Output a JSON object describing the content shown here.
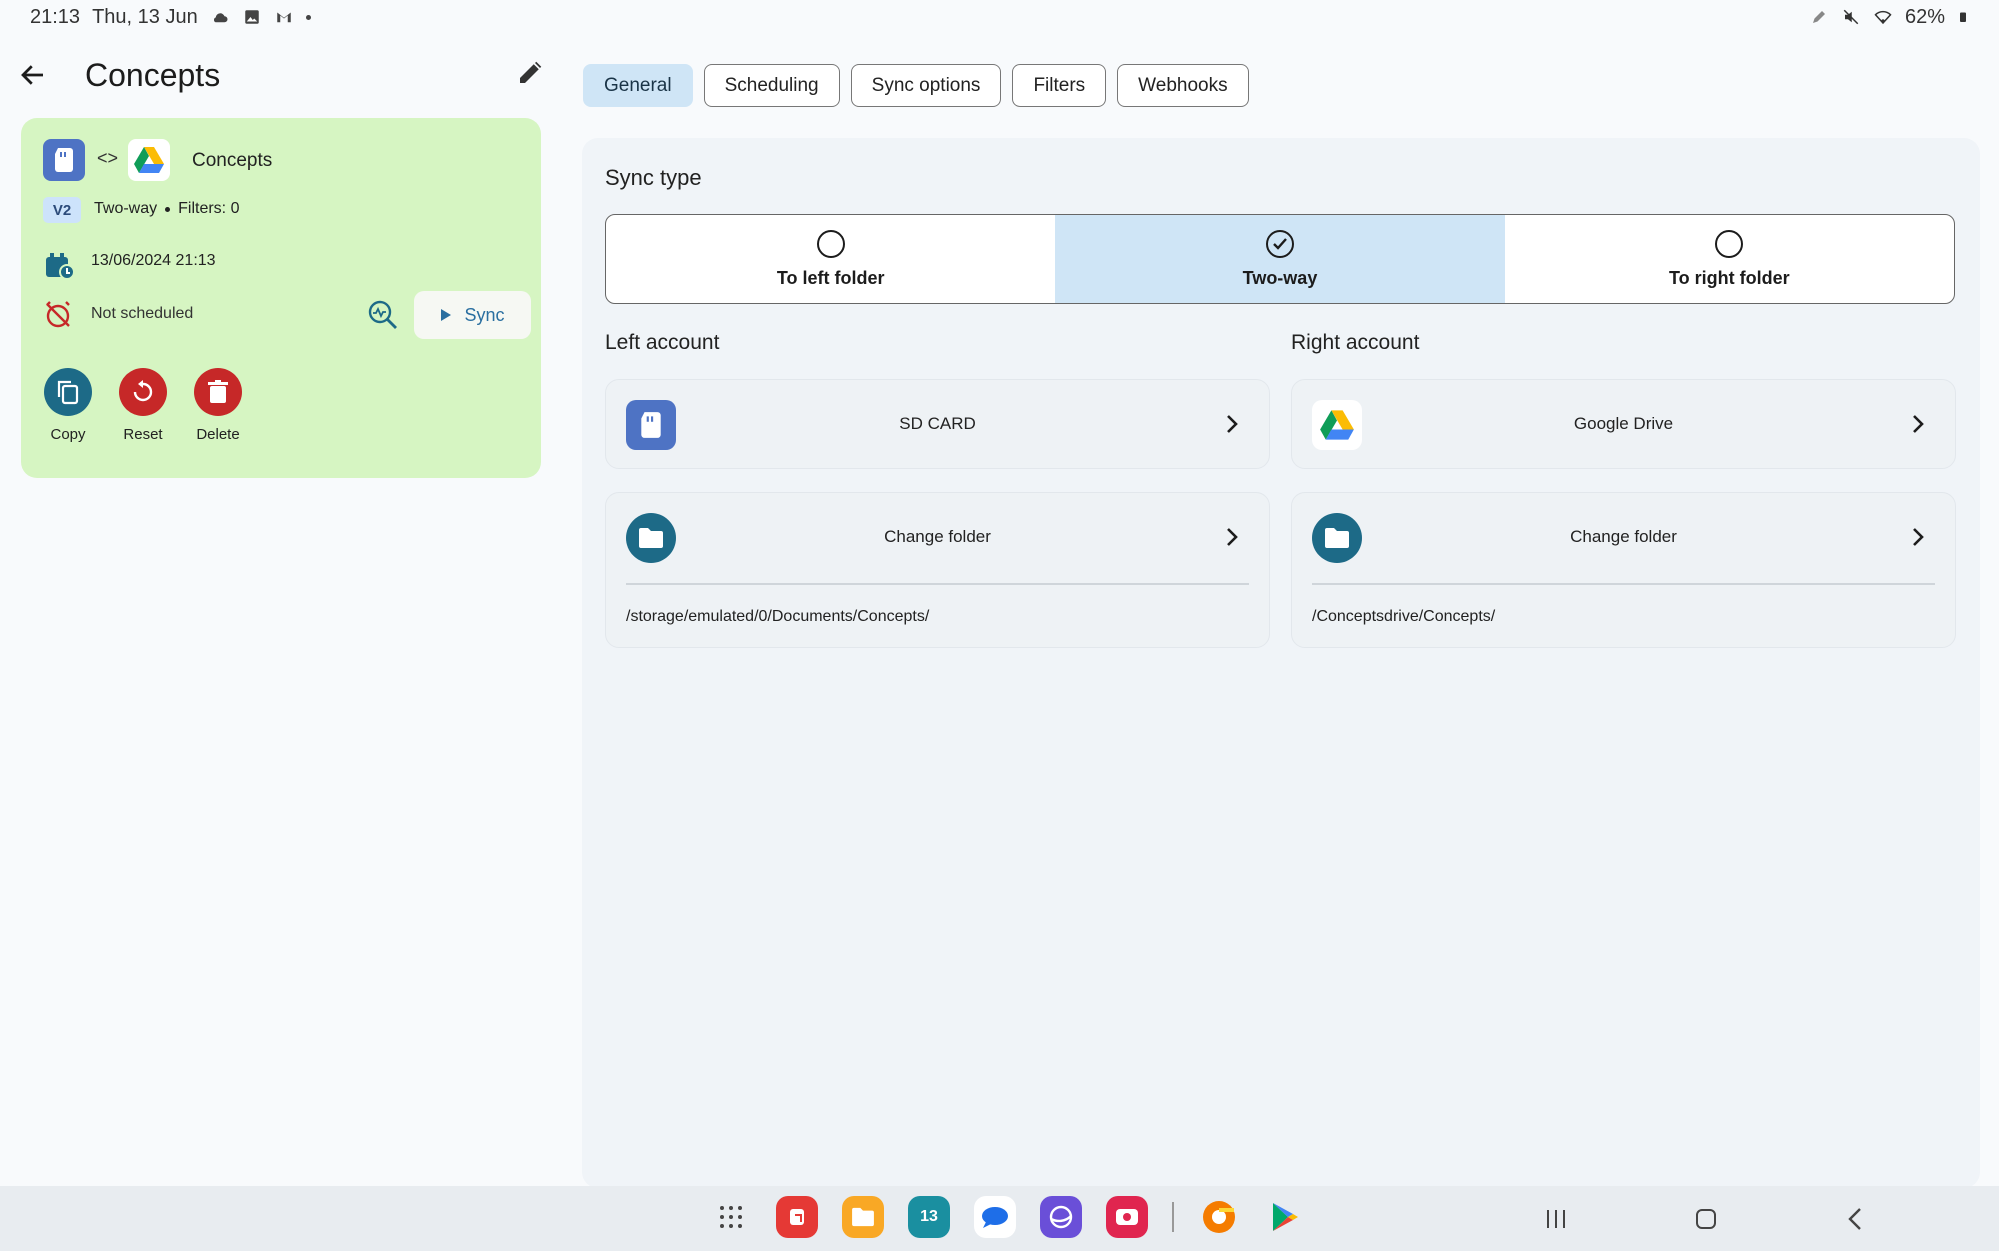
{
  "status_bar": {
    "time": "21:13",
    "date": "Thu, 13 Jun",
    "battery": "62%",
    "icons": [
      "cloud-icon",
      "gallery-icon",
      "gmail-icon",
      "dot-icon",
      "pen-icon",
      "mute-icon",
      "wifi-icon",
      "battery-icon"
    ]
  },
  "header": {
    "title": "Concepts",
    "back_icon": "arrow-left-icon",
    "edit_icon": "pencil-icon"
  },
  "task_card": {
    "name": "Concepts",
    "version_badge": "V2",
    "sync_type": "Two-way",
    "filters": "Filters: 0",
    "last_sync": "13/06/2024 21:13",
    "schedule": "Not scheduled",
    "sync_button": "Sync",
    "actions": [
      {
        "label": "Copy",
        "icon": "copy-icon",
        "color": "#1d6a87"
      },
      {
        "label": "Reset",
        "icon": "reset-icon",
        "color": "#c62828"
      },
      {
        "label": "Delete",
        "icon": "trash-icon",
        "color": "#c62828"
      }
    ],
    "card_color": "#d6f5c2"
  },
  "tabs": [
    {
      "label": "General",
      "active": true
    },
    {
      "label": "Scheduling",
      "active": false
    },
    {
      "label": "Sync options",
      "active": false
    },
    {
      "label": "Filters",
      "active": false
    },
    {
      "label": "Webhooks",
      "active": false
    }
  ],
  "sync_type": {
    "title": "Sync type",
    "options": [
      {
        "label": "To left folder",
        "selected": false
      },
      {
        "label": "Two-way",
        "selected": true
      },
      {
        "label": "To right folder",
        "selected": false
      }
    ]
  },
  "left_account": {
    "title": "Left account",
    "account_name": "SD CARD",
    "folder_label": "Change folder",
    "folder_path": "/storage/emulated/0/Documents/Concepts/"
  },
  "right_account": {
    "title": "Right account",
    "account_name": "Google Drive",
    "folder_label": "Change folder",
    "folder_path": "/Conceptsdrive/Concepts/"
  },
  "dock": {
    "apps": [
      "apps-grid-icon",
      "app-red-icon",
      "files-icon",
      "calendar-icon",
      "messages-icon",
      "internet-icon",
      "screen-recorder-icon",
      "chrome-icon",
      "play-store-icon"
    ],
    "calendar_day": "13"
  },
  "colors": {
    "accent": "#cfe5f6",
    "sync_text": "#2a6fa0",
    "folder_circle": "#1d6a87",
    "sd_card": "#4e73c4"
  }
}
